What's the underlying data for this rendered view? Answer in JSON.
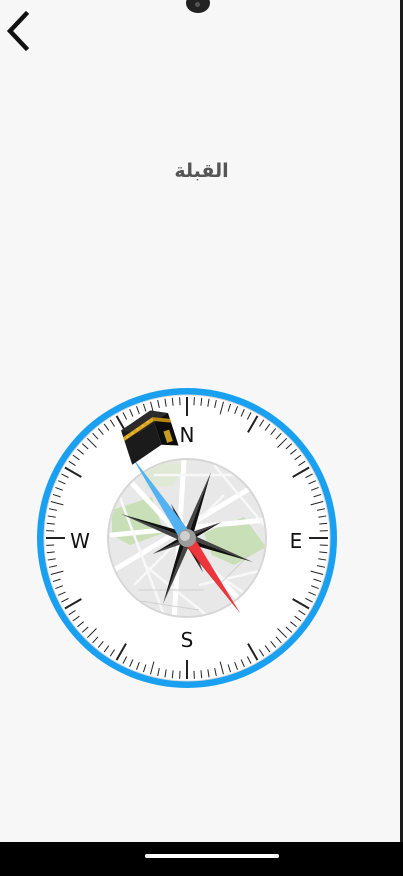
{
  "header": {
    "back_icon": "chevron-left-icon",
    "title": "القبلة"
  },
  "compass": {
    "directions": {
      "north": "N",
      "east": "E",
      "south": "S",
      "west": "W"
    },
    "ring_color": "#1aa0f0",
    "needle_north_color": "#2196f3",
    "needle_south_color": "#e3242b",
    "kaaba_icon": "kaaba-icon"
  },
  "system": {
    "camera_icon": "camera-icon"
  }
}
